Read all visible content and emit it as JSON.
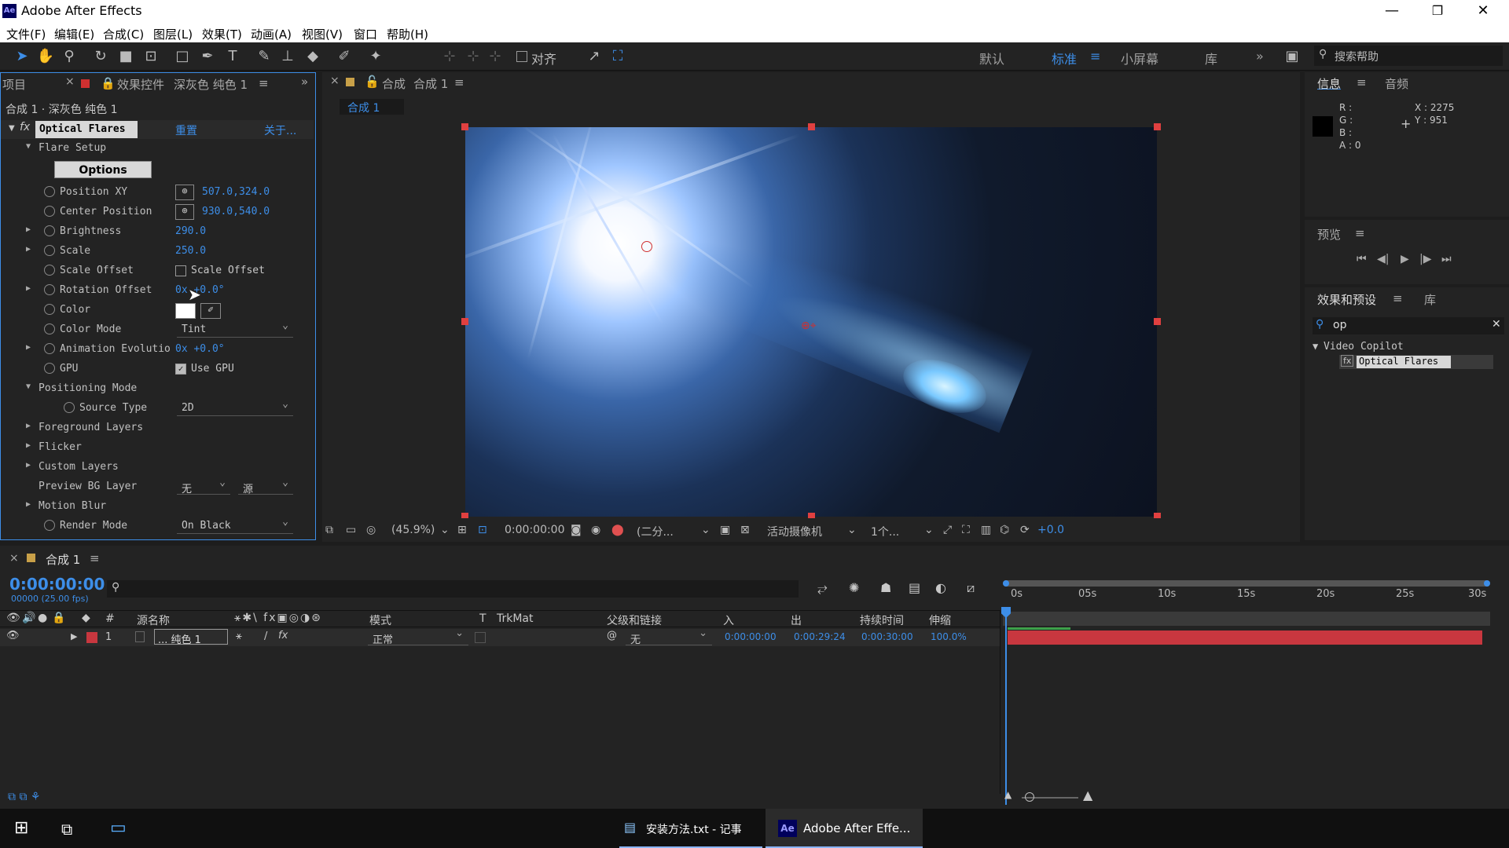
{
  "app": {
    "title": "Adobe After Effects",
    "logo": "Ae"
  },
  "menu": [
    "文件(F)",
    "编辑(E)",
    "合成(C)",
    "图层(L)",
    "效果(T)",
    "动画(A)",
    "视图(V)",
    "窗口",
    "帮助(H)"
  ],
  "toolbar": {
    "align_label": "对齐",
    "workspaces": [
      "默认",
      "标准",
      "小屏幕",
      "库"
    ],
    "active_workspace": "标准",
    "search_placeholder": "搜索帮助"
  },
  "effects_panel": {
    "tab_project": "项目",
    "tab_effects": "效果控件",
    "tab_layer": "深灰色 纯色 1",
    "breadcrumb": "合成 1 · 深灰色 纯色 1",
    "effect_name": "Optical Flares",
    "reset": "重置",
    "about": "关于...",
    "flare_setup": "Flare Setup",
    "options_button": "Options",
    "props": [
      {
        "name": "Position XY",
        "value": "507.0,324.0",
        "kind": "point"
      },
      {
        "name": "Center Position",
        "value": "930.0,540.0",
        "kind": "point"
      },
      {
        "name": "Brightness",
        "value": "290.0",
        "kind": "num",
        "expand": true
      },
      {
        "name": "Scale",
        "value": "250.0",
        "kind": "num",
        "expand": true
      },
      {
        "name": "Scale Offset",
        "value": "Scale Offset",
        "kind": "check",
        "checked": false
      },
      {
        "name": "Rotation Offset",
        "value": "0x +0.0°",
        "kind": "num",
        "expand": true
      },
      {
        "name": "Color",
        "value": "",
        "kind": "color"
      },
      {
        "name": "Color Mode",
        "value": "Tint",
        "kind": "select"
      },
      {
        "name": "Animation Evolutio",
        "value": "0x +0.0°",
        "kind": "num",
        "expand": true
      },
      {
        "name": "GPU",
        "value": "Use GPU",
        "kind": "check",
        "checked": true
      }
    ],
    "positioning_mode": "Positioning Mode",
    "source_type_label": "Source Type",
    "source_type_value": "2D",
    "groups": [
      "Foreground Layers",
      "Flicker",
      "Custom Layers"
    ],
    "preview_bg_label": "Preview BG Layer",
    "preview_bg_value1": "无",
    "preview_bg_value2": "源",
    "motion_blur": "Motion Blur",
    "render_mode_label": "Render Mode",
    "render_mode_value": "On Black"
  },
  "comp_panel": {
    "tab_prefix": "合成",
    "tab_name": "合成 1",
    "sub_tab": "合成 1"
  },
  "viewer_bar": {
    "zoom": "(45.9%)",
    "time": "0:00:00:00",
    "resolution": "(二分...",
    "camera": "活动摄像机",
    "views": "1个...",
    "exposure": "+0.0"
  },
  "info_panel": {
    "tab_info": "信息",
    "tab_audio": "音频",
    "r": "R :",
    "g": "G :",
    "b": "B :",
    "a": "A : 0",
    "x": "X : 2275",
    "y": "Y : 951"
  },
  "preview_panel": {
    "title": "预览"
  },
  "fx_presets": {
    "title": "效果和预设",
    "tab_lib": "库",
    "search": "op",
    "group": "Video Copilot",
    "item": "Optical Flares"
  },
  "timeline": {
    "tab": "合成 1",
    "timecode": "0:00:00:00",
    "fps": "00000 (25.00 fps)",
    "columns": [
      "源名称",
      "模式",
      "T",
      "TrkMat",
      "父级和链接",
      "入",
      "出",
      "持续时间",
      "伸缩"
    ],
    "ruler": [
      "0s",
      "05s",
      "10s",
      "15s",
      "20s",
      "25s",
      "30s"
    ],
    "layer": {
      "num": "1",
      "name": "... 纯色 1",
      "mode": "正常",
      "parent": "无",
      "in": "0:00:00:00",
      "out": "0:00:29:24",
      "duration": "0:00:30:00",
      "stretch": "100.0%"
    },
    "layer_color": "#c8373f"
  },
  "taskbar": {
    "items": [
      {
        "label": "安装方法.txt - 记事"
      },
      {
        "label": "Adobe After Effe...",
        "active": true
      }
    ]
  }
}
